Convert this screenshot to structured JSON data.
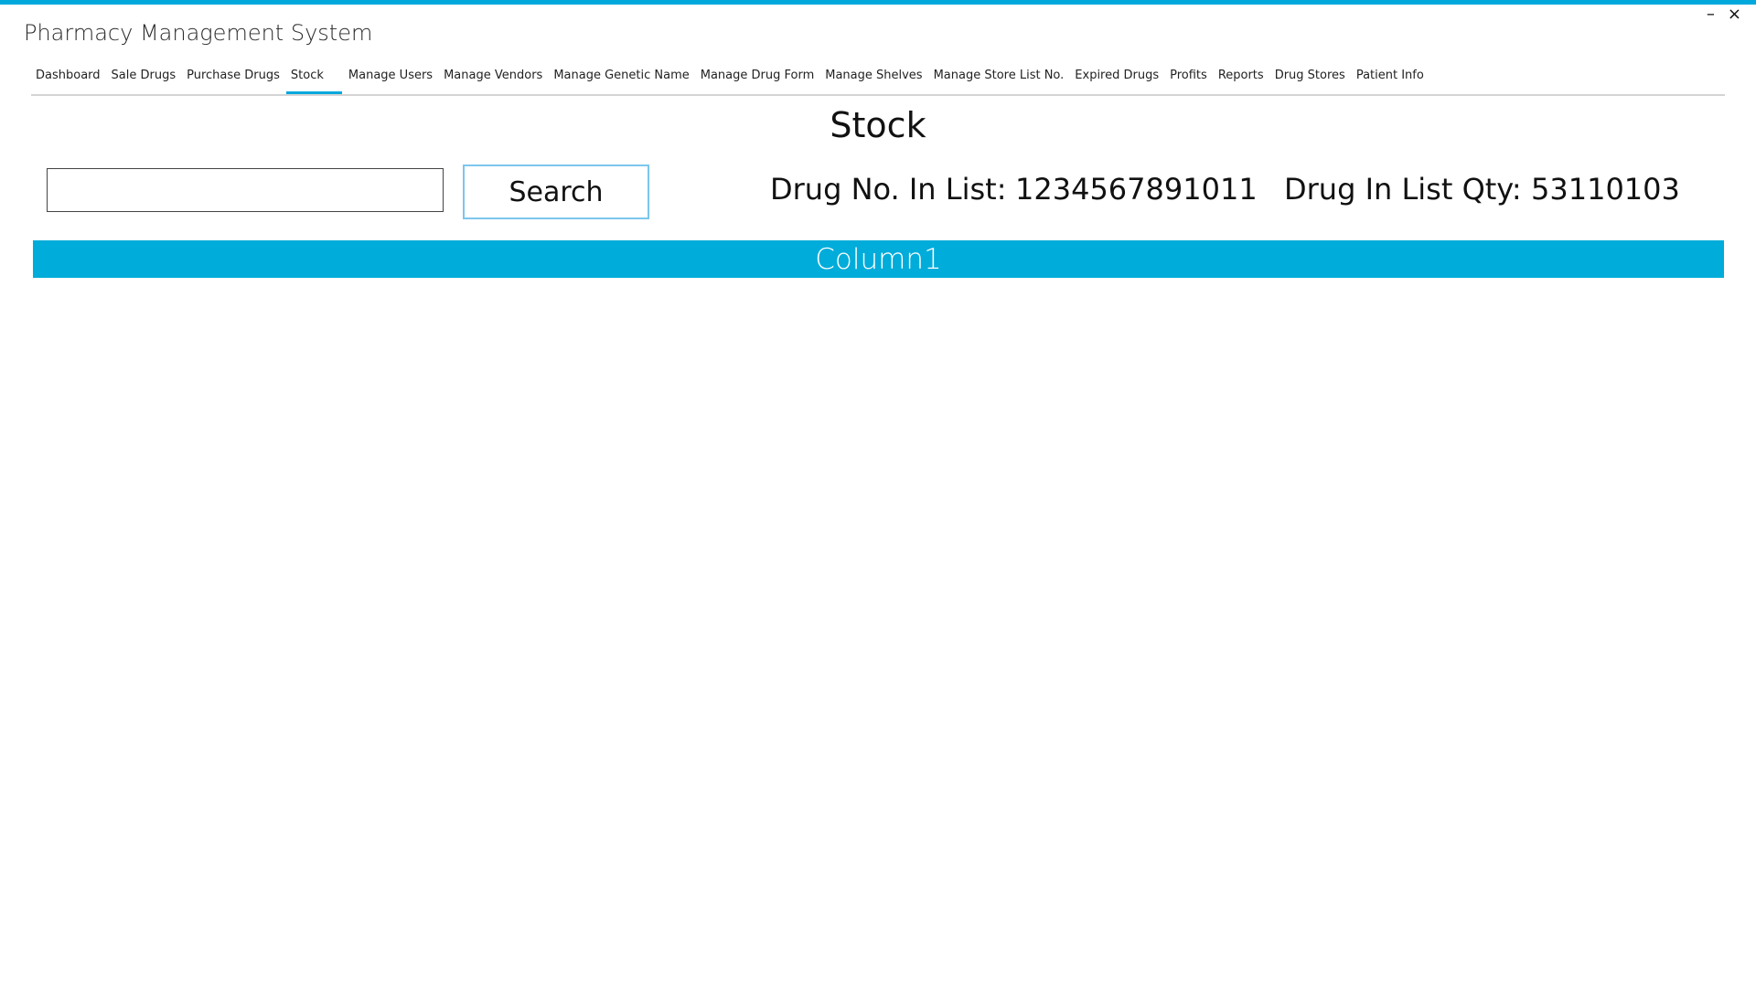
{
  "app": {
    "title": "Pharmacy Management System",
    "accent_color": "#00a8dc"
  },
  "window_controls": {
    "minimize_icon": "minimize-icon",
    "minimize_label": "–",
    "close_icon": "close-icon",
    "close_label": "×"
  },
  "tabs": [
    {
      "label": "Dashboard",
      "active": false
    },
    {
      "label": "Sale Drugs",
      "active": false
    },
    {
      "label": "Purchase Drugs",
      "active": false
    },
    {
      "label": "Stock",
      "active": true
    },
    {
      "label": "Manage Users",
      "active": false
    },
    {
      "label": "Manage Vendors",
      "active": false
    },
    {
      "label": "Manage Genetic Name",
      "active": false
    },
    {
      "label": "Manage Drug Form",
      "active": false
    },
    {
      "label": "Manage Shelves",
      "active": false
    },
    {
      "label": "Manage Store List No.",
      "active": false
    },
    {
      "label": "Expired Drugs",
      "active": false
    },
    {
      "label": "Profits",
      "active": false
    },
    {
      "label": "Reports",
      "active": false
    },
    {
      "label": "Drug Stores",
      "active": false
    },
    {
      "label": "Patient Info",
      "active": false
    }
  ],
  "page": {
    "title": "Stock"
  },
  "search": {
    "value": "",
    "placeholder": "",
    "button_label": "Search"
  },
  "stats": {
    "drug_no_label": "Drug No. In List:",
    "drug_no_value": "1234567891011",
    "drug_qty_label": "Drug In List Qty:",
    "drug_qty_value": "53110103"
  },
  "grid": {
    "columns": [
      "Column1"
    ],
    "header_color": "#00acda",
    "rows": []
  }
}
